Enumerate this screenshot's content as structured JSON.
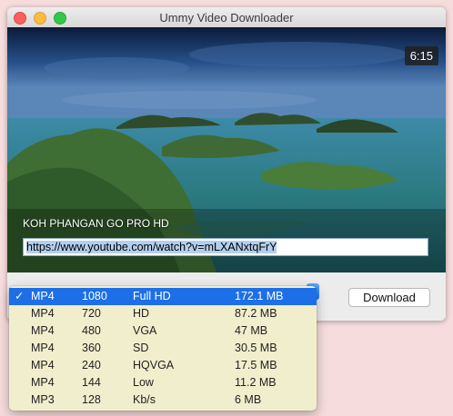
{
  "window": {
    "title": "Ummy Video Downloader"
  },
  "video": {
    "duration": "6:15",
    "title": "KOH PHANGAN GO PRO HD",
    "url": "https://www.youtube.com/watch?v=mLXANxtqFrY"
  },
  "actions": {
    "download_label": "Download"
  },
  "formats": [
    {
      "check": "✓",
      "format": "MP4",
      "resolution": "1080",
      "quality": "Full HD",
      "size": "172.1 MB",
      "selected": true
    },
    {
      "check": "",
      "format": "MP4",
      "resolution": "720",
      "quality": "HD",
      "size": "87.2 MB",
      "selected": false
    },
    {
      "check": "",
      "format": "MP4",
      "resolution": "480",
      "quality": "VGA",
      "size": "47 MB",
      "selected": false
    },
    {
      "check": "",
      "format": "MP4",
      "resolution": "360",
      "quality": "SD",
      "size": "30.5 MB",
      "selected": false
    },
    {
      "check": "",
      "format": "MP4",
      "resolution": "240",
      "quality": "HQVGA",
      "size": "17.5 MB",
      "selected": false
    },
    {
      "check": "",
      "format": "MP4",
      "resolution": "144",
      "quality": "Low",
      "size": "11.2 MB",
      "selected": false
    },
    {
      "check": "",
      "format": "MP3",
      "resolution": "128",
      "quality": "Kb/s",
      "size": "6 MB",
      "selected": false
    }
  ],
  "icons": {
    "dropdown": "chevron-updown-icon",
    "selected": "checkmark-icon"
  },
  "colors": {
    "selection": "#1d6fe8",
    "menu_background": "#f1eecd",
    "url_selection": "#b4cfee"
  }
}
